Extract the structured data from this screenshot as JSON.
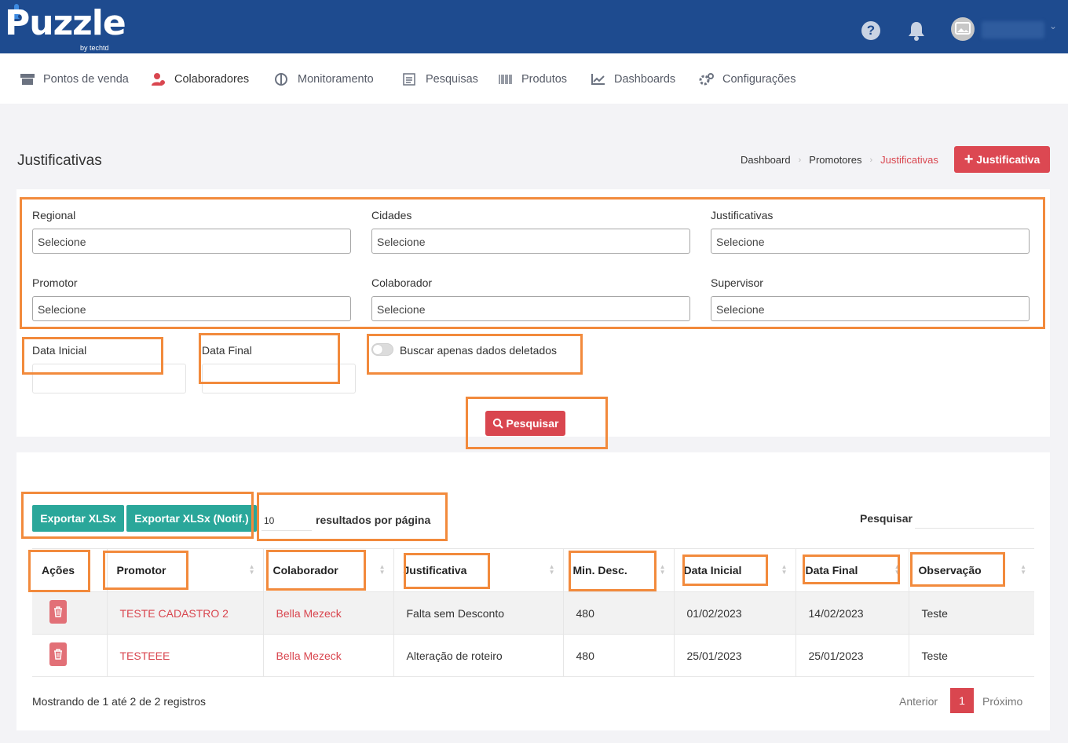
{
  "app": {
    "logo": "Puzzle",
    "logo_sub": "by techtd",
    "help": "?"
  },
  "nav": [
    {
      "label": "Pontos de venda",
      "icon": "store-icon"
    },
    {
      "label": "Colaboradores",
      "icon": "users-icon"
    },
    {
      "label": "Monitoramento",
      "icon": "monitor-icon"
    },
    {
      "label": "Pesquisas",
      "icon": "survey-icon"
    },
    {
      "label": "Produtos",
      "icon": "barcode-icon"
    },
    {
      "label": "Dashboards",
      "icon": "chart-line-icon"
    },
    {
      "label": "Configurações",
      "icon": "gears-icon"
    }
  ],
  "page": {
    "title": "Justificativas",
    "add_button": "Justificativa"
  },
  "breadcrumb": [
    "Dashboard",
    "Promotores",
    "Justificativas"
  ],
  "filters": {
    "regional": {
      "label": "Regional",
      "value": "Selecione"
    },
    "cidades": {
      "label": "Cidades",
      "value": "Selecione"
    },
    "justificativas": {
      "label": "Justificativas",
      "value": "Selecione"
    },
    "promotor": {
      "label": "Promotor",
      "value": "Selecione"
    },
    "colaborador": {
      "label": "Colaborador",
      "value": "Selecione"
    },
    "supervisor": {
      "label": "Supervisor",
      "value": "Selecione"
    },
    "data_inicial": {
      "label": "Data Inicial"
    },
    "data_final": {
      "label": "Data Final"
    },
    "deleted_toggle": "Buscar apenas dados deletados",
    "search_button": "Pesquisar"
  },
  "results": {
    "export_xlsx": "Exportar XLSx",
    "export_xlsx_notif": "Exportar XLSx (Notif.)",
    "page_size": "10",
    "page_size_label": "resultados por página",
    "search_label": "Pesquisar",
    "columns": [
      "Ações",
      "Promotor",
      "Colaborador",
      "Justificativa",
      "Min. Desc.",
      "Data Inicial",
      "Data Final",
      "Observação"
    ],
    "rows": [
      {
        "promotor": "TESTE CADASTRO 2",
        "colaborador": "Bella Mezeck",
        "justificativa": "Falta sem Desconto",
        "min_desc": "480",
        "data_inicial": "01/02/2023",
        "data_final": "14/02/2023",
        "observacao": "Teste"
      },
      {
        "promotor": "TESTEEE",
        "colaborador": "Bella Mezeck",
        "justificativa": "Alteração de roteiro",
        "min_desc": "480",
        "data_inicial": "25/01/2023",
        "data_final": "25/01/2023",
        "observacao": "Teste"
      }
    ],
    "info": "Mostrando de 1 até 2 de 2 registros",
    "pagination": {
      "prev": "Anterior",
      "current": "1",
      "next": "Próximo"
    }
  },
  "colors": {
    "header": "#1e4b8f",
    "accent": "#d9464f",
    "export": "#2aa79a",
    "highlight": "#f28a3c"
  }
}
